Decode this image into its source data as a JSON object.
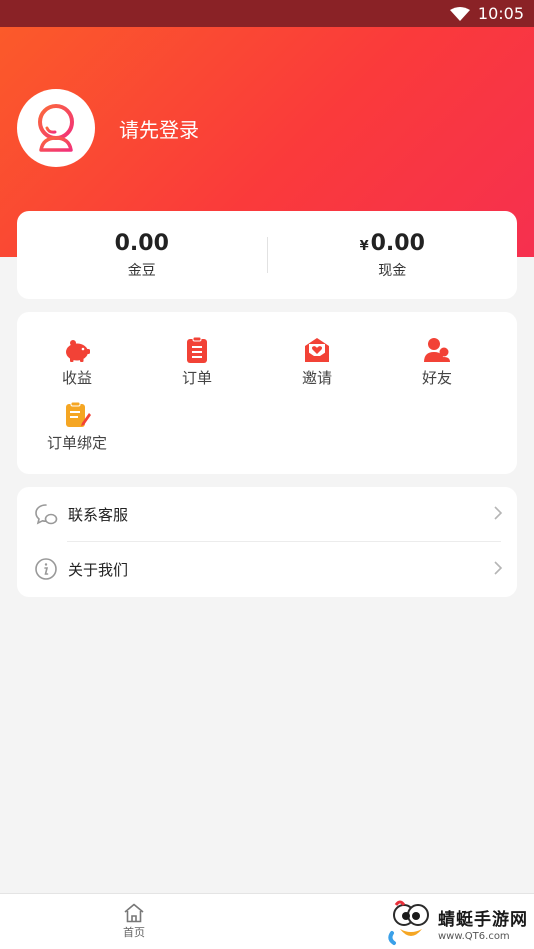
{
  "status_bar": {
    "time": "10:05",
    "icons": [
      "wifi-icon"
    ]
  },
  "profile": {
    "login_text": "请先登录",
    "avatar_icon": "default-avatar-icon"
  },
  "balance": [
    {
      "value": "0.00",
      "currency": "",
      "label": "金豆"
    },
    {
      "value": "0.00",
      "currency": "¥",
      "label": "现金"
    }
  ],
  "menu": [
    {
      "label": "收益",
      "icon": "piggy-bank-icon"
    },
    {
      "label": "订单",
      "icon": "clipboard-icon"
    },
    {
      "label": "邀请",
      "icon": "envelope-heart-icon"
    },
    {
      "label": "好友",
      "icon": "friends-icon"
    },
    {
      "label": "订单绑定",
      "icon": "order-bind-icon"
    }
  ],
  "list": [
    {
      "label": "联系客服",
      "icon": "chat-bubble-icon"
    },
    {
      "label": "关于我们",
      "icon": "info-icon"
    }
  ],
  "tab_bar": {
    "home_label": "首页"
  },
  "watermark": {
    "title": "蜻蜓手游网",
    "url": "www.QT6.com"
  },
  "colors": {
    "accent": "#fa3a3b",
    "gradient_start": "#fb5a2a",
    "gradient_end": "#f6304f",
    "status_bar": "#8a2226"
  }
}
